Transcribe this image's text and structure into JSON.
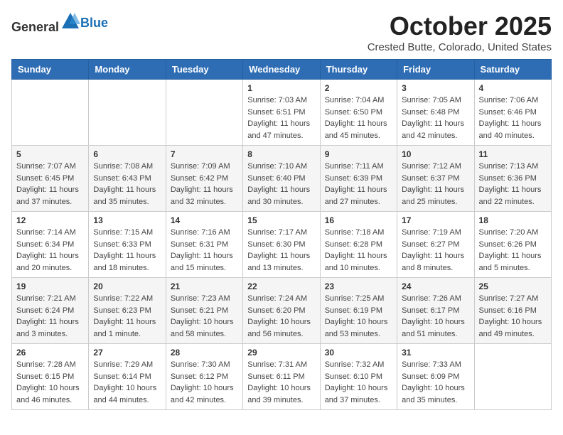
{
  "header": {
    "logo_general": "General",
    "logo_blue": "Blue",
    "month": "October 2025",
    "location": "Crested Butte, Colorado, United States"
  },
  "days_of_week": [
    "Sunday",
    "Monday",
    "Tuesday",
    "Wednesday",
    "Thursday",
    "Friday",
    "Saturday"
  ],
  "weeks": [
    [
      {
        "day": "",
        "info": ""
      },
      {
        "day": "",
        "info": ""
      },
      {
        "day": "",
        "info": ""
      },
      {
        "day": "1",
        "info": "Sunrise: 7:03 AM\nSunset: 6:51 PM\nDaylight: 11 hours\nand 47 minutes."
      },
      {
        "day": "2",
        "info": "Sunrise: 7:04 AM\nSunset: 6:50 PM\nDaylight: 11 hours\nand 45 minutes."
      },
      {
        "day": "3",
        "info": "Sunrise: 7:05 AM\nSunset: 6:48 PM\nDaylight: 11 hours\nand 42 minutes."
      },
      {
        "day": "4",
        "info": "Sunrise: 7:06 AM\nSunset: 6:46 PM\nDaylight: 11 hours\nand 40 minutes."
      }
    ],
    [
      {
        "day": "5",
        "info": "Sunrise: 7:07 AM\nSunset: 6:45 PM\nDaylight: 11 hours\nand 37 minutes."
      },
      {
        "day": "6",
        "info": "Sunrise: 7:08 AM\nSunset: 6:43 PM\nDaylight: 11 hours\nand 35 minutes."
      },
      {
        "day": "7",
        "info": "Sunrise: 7:09 AM\nSunset: 6:42 PM\nDaylight: 11 hours\nand 32 minutes."
      },
      {
        "day": "8",
        "info": "Sunrise: 7:10 AM\nSunset: 6:40 PM\nDaylight: 11 hours\nand 30 minutes."
      },
      {
        "day": "9",
        "info": "Sunrise: 7:11 AM\nSunset: 6:39 PM\nDaylight: 11 hours\nand 27 minutes."
      },
      {
        "day": "10",
        "info": "Sunrise: 7:12 AM\nSunset: 6:37 PM\nDaylight: 11 hours\nand 25 minutes."
      },
      {
        "day": "11",
        "info": "Sunrise: 7:13 AM\nSunset: 6:36 PM\nDaylight: 11 hours\nand 22 minutes."
      }
    ],
    [
      {
        "day": "12",
        "info": "Sunrise: 7:14 AM\nSunset: 6:34 PM\nDaylight: 11 hours\nand 20 minutes."
      },
      {
        "day": "13",
        "info": "Sunrise: 7:15 AM\nSunset: 6:33 PM\nDaylight: 11 hours\nand 18 minutes."
      },
      {
        "day": "14",
        "info": "Sunrise: 7:16 AM\nSunset: 6:31 PM\nDaylight: 11 hours\nand 15 minutes."
      },
      {
        "day": "15",
        "info": "Sunrise: 7:17 AM\nSunset: 6:30 PM\nDaylight: 11 hours\nand 13 minutes."
      },
      {
        "day": "16",
        "info": "Sunrise: 7:18 AM\nSunset: 6:28 PM\nDaylight: 11 hours\nand 10 minutes."
      },
      {
        "day": "17",
        "info": "Sunrise: 7:19 AM\nSunset: 6:27 PM\nDaylight: 11 hours\nand 8 minutes."
      },
      {
        "day": "18",
        "info": "Sunrise: 7:20 AM\nSunset: 6:26 PM\nDaylight: 11 hours\nand 5 minutes."
      }
    ],
    [
      {
        "day": "19",
        "info": "Sunrise: 7:21 AM\nSunset: 6:24 PM\nDaylight: 11 hours\nand 3 minutes."
      },
      {
        "day": "20",
        "info": "Sunrise: 7:22 AM\nSunset: 6:23 PM\nDaylight: 11 hours\nand 1 minute."
      },
      {
        "day": "21",
        "info": "Sunrise: 7:23 AM\nSunset: 6:21 PM\nDaylight: 10 hours\nand 58 minutes."
      },
      {
        "day": "22",
        "info": "Sunrise: 7:24 AM\nSunset: 6:20 PM\nDaylight: 10 hours\nand 56 minutes."
      },
      {
        "day": "23",
        "info": "Sunrise: 7:25 AM\nSunset: 6:19 PM\nDaylight: 10 hours\nand 53 minutes."
      },
      {
        "day": "24",
        "info": "Sunrise: 7:26 AM\nSunset: 6:17 PM\nDaylight: 10 hours\nand 51 minutes."
      },
      {
        "day": "25",
        "info": "Sunrise: 7:27 AM\nSunset: 6:16 PM\nDaylight: 10 hours\nand 49 minutes."
      }
    ],
    [
      {
        "day": "26",
        "info": "Sunrise: 7:28 AM\nSunset: 6:15 PM\nDaylight: 10 hours\nand 46 minutes."
      },
      {
        "day": "27",
        "info": "Sunrise: 7:29 AM\nSunset: 6:14 PM\nDaylight: 10 hours\nand 44 minutes."
      },
      {
        "day": "28",
        "info": "Sunrise: 7:30 AM\nSunset: 6:12 PM\nDaylight: 10 hours\nand 42 minutes."
      },
      {
        "day": "29",
        "info": "Sunrise: 7:31 AM\nSunset: 6:11 PM\nDaylight: 10 hours\nand 39 minutes."
      },
      {
        "day": "30",
        "info": "Sunrise: 7:32 AM\nSunset: 6:10 PM\nDaylight: 10 hours\nand 37 minutes."
      },
      {
        "day": "31",
        "info": "Sunrise: 7:33 AM\nSunset: 6:09 PM\nDaylight: 10 hours\nand 35 minutes."
      },
      {
        "day": "",
        "info": ""
      }
    ]
  ]
}
